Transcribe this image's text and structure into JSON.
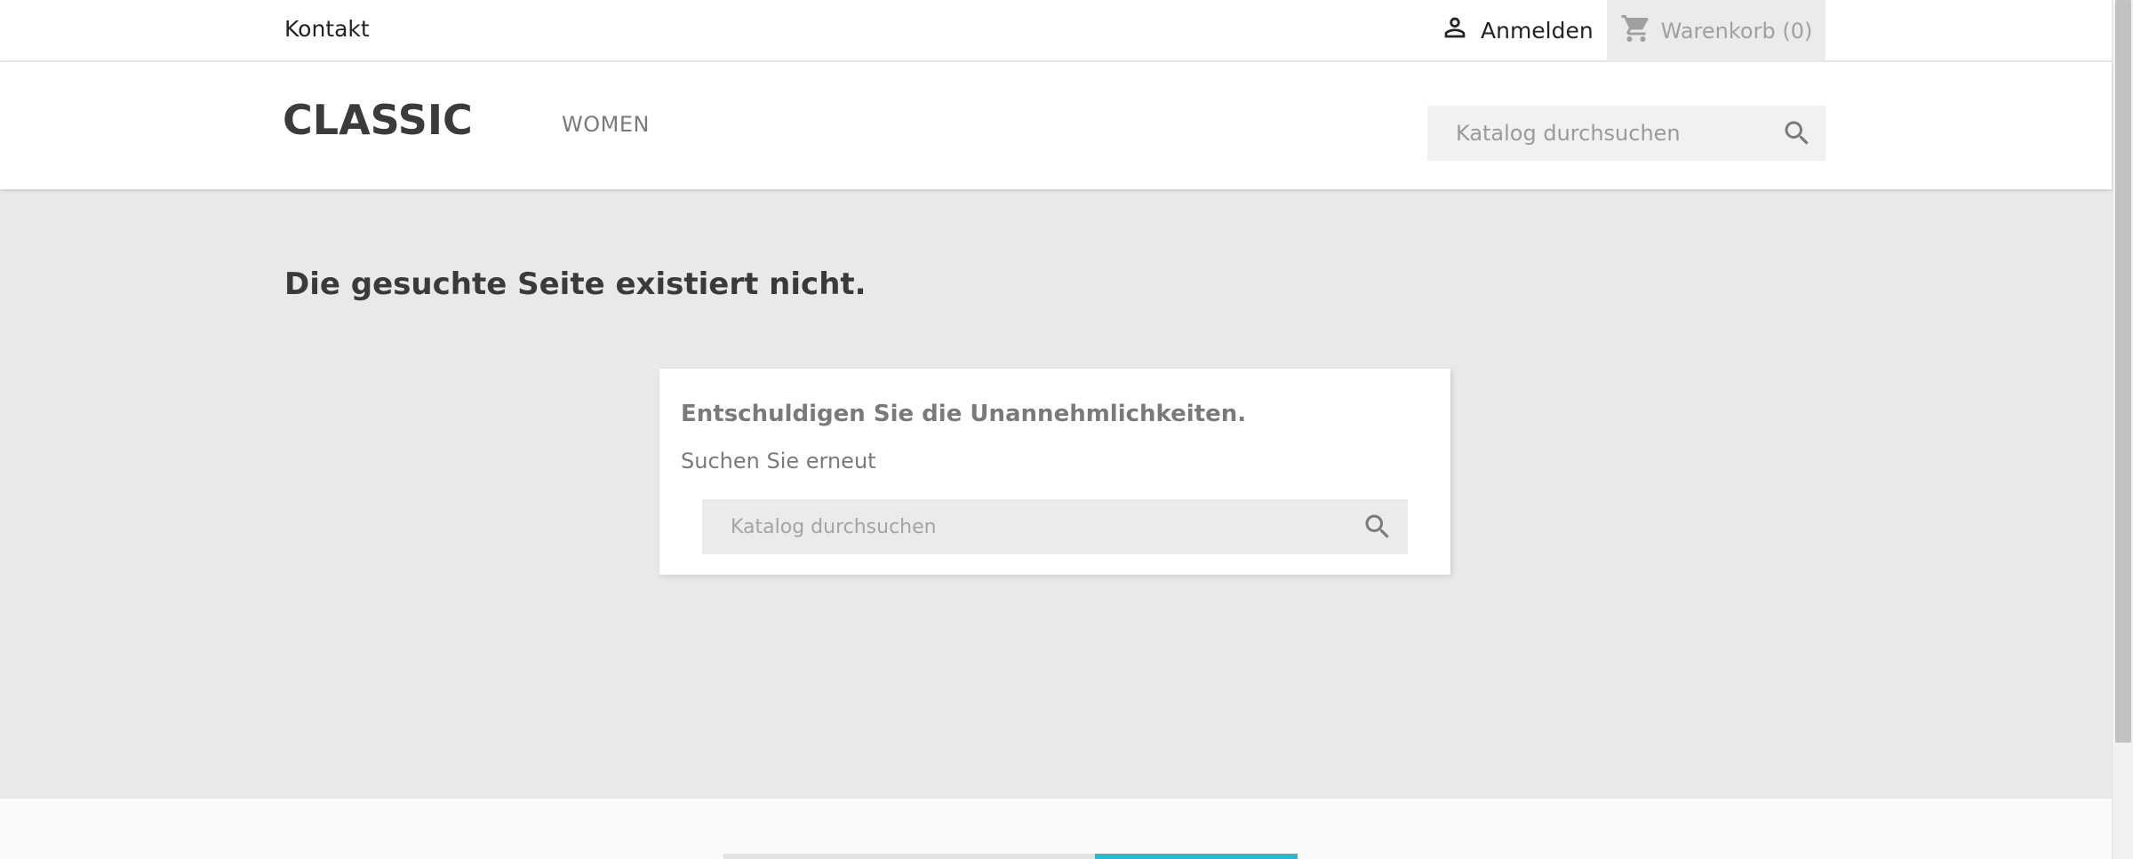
{
  "topbar": {
    "contact_label": "Kontakt",
    "signin_label": "Anmelden",
    "cart_label": "Warenkorb (0)"
  },
  "header": {
    "logo_text": "CLASSIC",
    "nav": [
      {
        "label": "WOMEN"
      }
    ],
    "search_placeholder": "Katalog durchsuchen"
  },
  "main": {
    "page_title": "Die gesuchte Seite existiert nicht.",
    "card": {
      "title": "Entschuldigen Sie die Unannehmlichkeiten.",
      "text": "Suchen Sie erneut",
      "search_placeholder": "Katalog durchsuchen"
    }
  },
  "icons": {
    "user": "user-icon",
    "cart": "cart-icon",
    "search": "search-icon"
  },
  "colors": {
    "accent": "#24b9d7",
    "background_main": "#e9e9e9",
    "cart_background": "#ebebeb"
  }
}
